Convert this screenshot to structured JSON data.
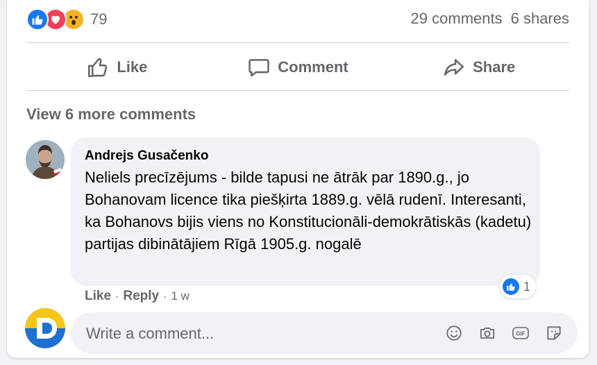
{
  "reactions": {
    "icons": [
      "like-icon",
      "love-icon",
      "wow-icon"
    ],
    "count": "79"
  },
  "stats": {
    "comments": "29 comments",
    "shares": "6 shares"
  },
  "actions": {
    "like": "Like",
    "comment": "Comment",
    "share": "Share"
  },
  "view_more": "View 6 more comments",
  "comment": {
    "author": "Andrejs Gusačenko",
    "text": "Neliels precīzējums - bilde tapusi ne ātrāk par 1890.g., jo Bohanovam licence tika piešķirta 1889.g. vēlā rudenī. Interesanti, ka Bohanovs bijis viens no Konstitucionāli-demokrātiskās (kadetu) partijas dibinātājiem Rīgā 1905.g. nogalē",
    "reaction_count": "1",
    "like": "Like",
    "sep": "·",
    "reply": "Reply",
    "time": "1 w"
  },
  "composer": {
    "placeholder": "Write a comment...",
    "tools": [
      "emoji-icon",
      "camera-icon",
      "gif-icon",
      "sticker-icon"
    ]
  },
  "colors": {
    "accent": "#1877f2",
    "love": "#f33e58",
    "wow": "#f7b125",
    "secondary_text": "#65676b",
    "bubble": "#f0f2f5"
  }
}
